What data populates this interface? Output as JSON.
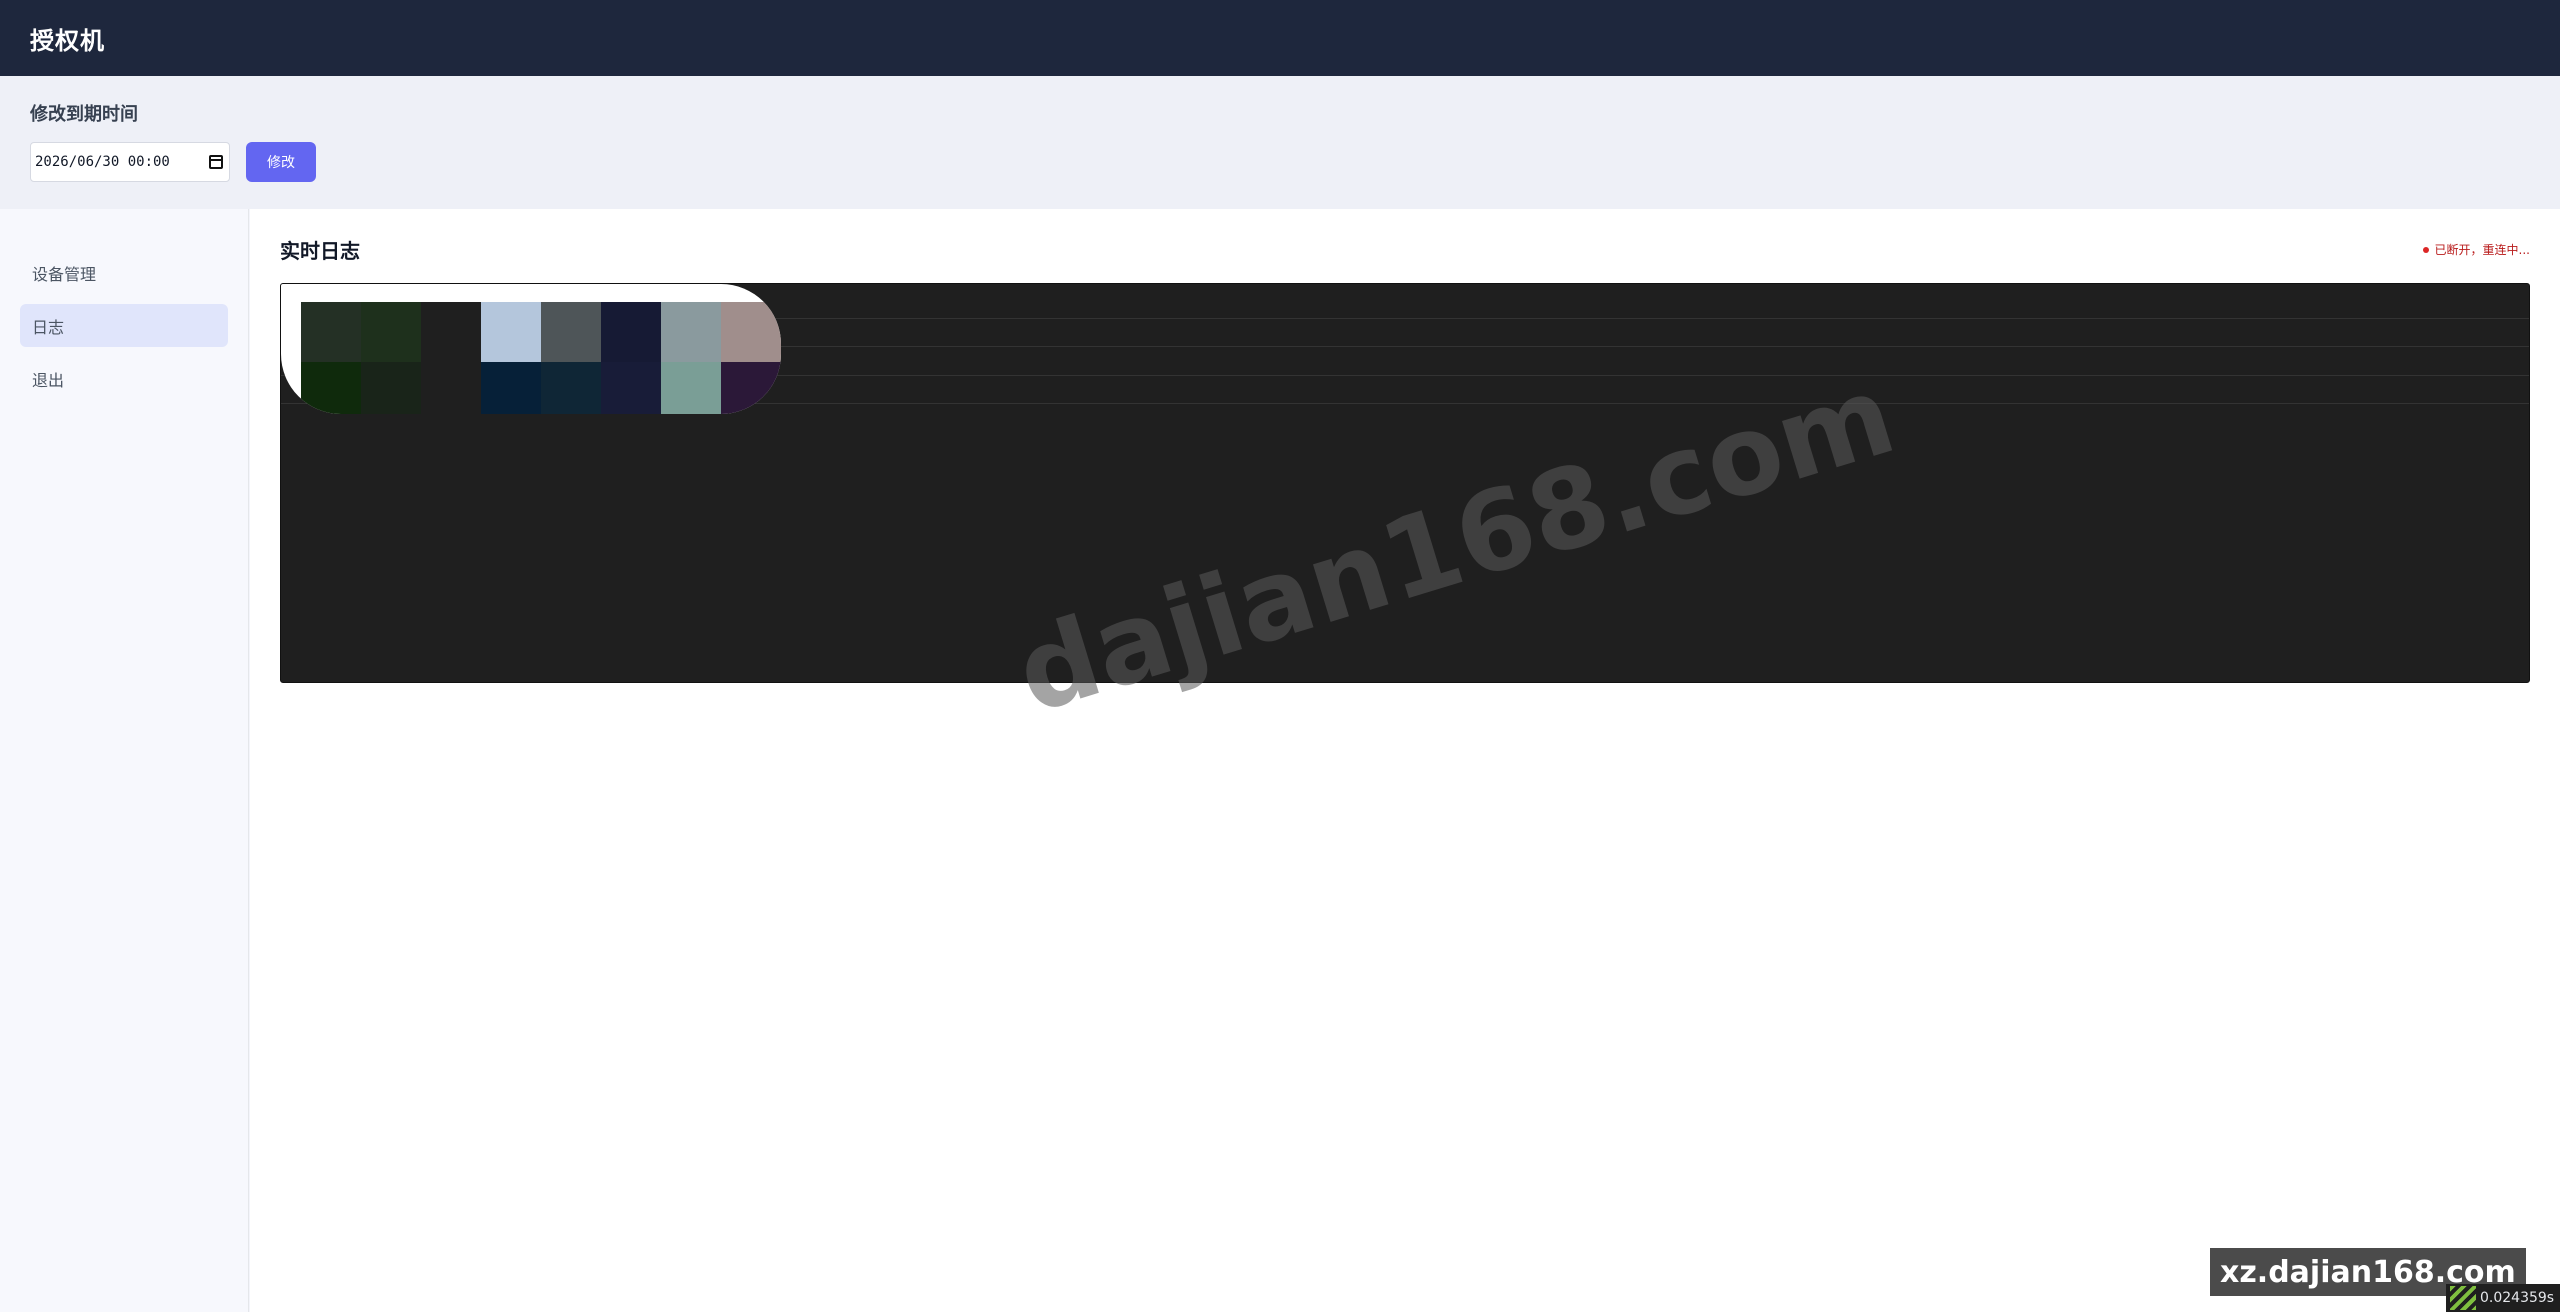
{
  "header": {
    "title": "授权机"
  },
  "expiry": {
    "heading": "修改到期时间",
    "datetime_value": "2026/06/30 00:00",
    "submit_label": "修改"
  },
  "sidebar": {
    "items": [
      {
        "label": "设备管理",
        "active": false
      },
      {
        "label": "日志",
        "active": true
      },
      {
        "label": "退出",
        "active": false
      }
    ]
  },
  "log_panel": {
    "title": "实时日志",
    "status": "已断开，重连中..."
  },
  "overlays": {
    "watermark": "dajian168.com",
    "badge": "xz.dajian168.com",
    "timer": "0.024359s"
  },
  "colors": {
    "topbar": "#1e273d",
    "accent": "#6366f1",
    "console_bg": "#1f1f1f",
    "status_error": "#dc2626"
  }
}
